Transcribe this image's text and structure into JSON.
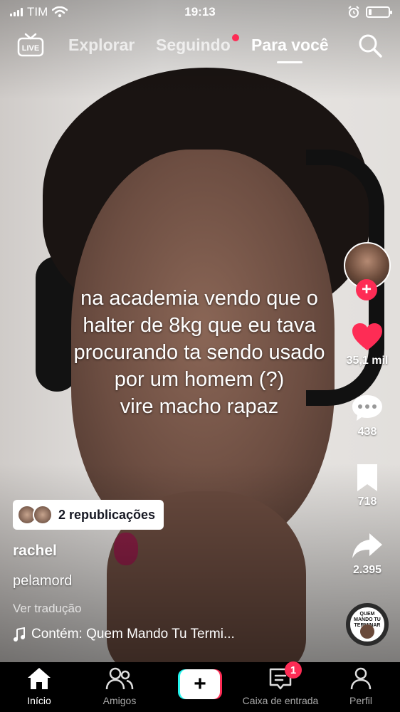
{
  "status_bar": {
    "carrier": "TIM",
    "time": "19:13",
    "battery_level": 0.15
  },
  "top_nav": {
    "live_label": "LIVE",
    "tabs": [
      {
        "label": "Explorar",
        "active": false
      },
      {
        "label": "Seguindo",
        "active": false,
        "has_dot": true
      },
      {
        "label": "Para você",
        "active": true
      }
    ],
    "icons": {
      "live": "live-tv-icon",
      "search": "search-icon"
    }
  },
  "caption": {
    "lines": [
      "na academia vendo que o",
      "halter de 8kg que eu tava",
      "procurando ta sendo usado",
      "por um homem (?)",
      "vire macho rapaz"
    ]
  },
  "right_rail": {
    "likes": "35,1 mil",
    "comments": "438",
    "saves": "718",
    "shares": "2.395",
    "accent": "#fe2c55"
  },
  "post": {
    "republications": "2 republicações",
    "username": "rachel",
    "description": "pelamord",
    "translate": "Ver tradução",
    "music": "Contém: Quem Mando Tu Termi...",
    "disc_text": "QUEM MANDO TU TERMINAR"
  },
  "bottom_nav": {
    "items": [
      {
        "label": "Início",
        "active": true
      },
      {
        "label": "Amigos",
        "active": false
      },
      {
        "label": "Caixa de entrada",
        "active": false
      },
      {
        "label": "Perfil",
        "active": false
      }
    ],
    "inbox_badge": "1"
  }
}
